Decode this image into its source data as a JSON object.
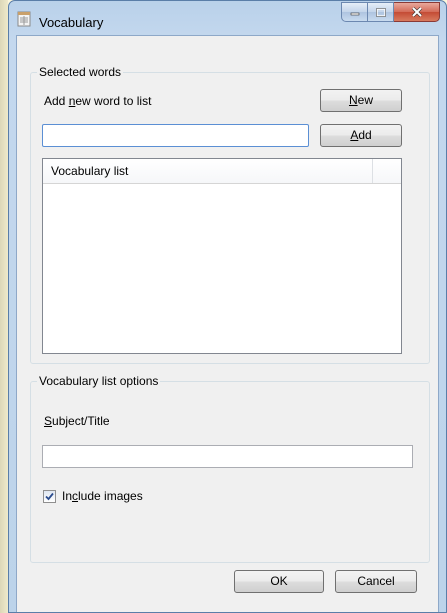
{
  "window": {
    "title": "Vocabulary",
    "icon": "document-icon"
  },
  "selected_words": {
    "group_label": "Selected words",
    "add_label_prefix": "Add ",
    "add_label_access": "n",
    "add_label_suffix": "ew word to list",
    "new_word_value": "",
    "new_button_access": "N",
    "new_button_rest": "ew",
    "add_button_access": "A",
    "add_button_rest": "dd",
    "list_column_header": "Vocabulary list",
    "list_items": []
  },
  "options": {
    "group_label": "Vocabulary list options",
    "subject_label_access": "S",
    "subject_label_rest": "ubject/Title",
    "subject_value": "",
    "include_images_prefix": "In",
    "include_images_access": "c",
    "include_images_rest": "lude images",
    "include_images_checked": true
  },
  "footer": {
    "ok_label": "OK",
    "cancel_label": "Cancel"
  }
}
